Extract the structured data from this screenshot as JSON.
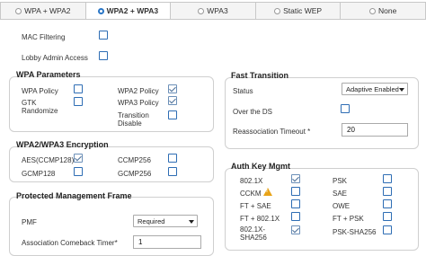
{
  "tabs": [
    {
      "label": "WPA + WPA2",
      "selected": false
    },
    {
      "label": "WPA2 + WPA3",
      "selected": true
    },
    {
      "label": "WPA3",
      "selected": false
    },
    {
      "label": "Static WEP",
      "selected": false
    },
    {
      "label": "None",
      "selected": false
    }
  ],
  "top_options": {
    "mac_filtering": {
      "label": "MAC Filtering",
      "checked": false
    },
    "lobby_admin_access": {
      "label": "Lobby Admin Access",
      "checked": false
    }
  },
  "wpa_parameters": {
    "title": "WPA Parameters",
    "wpa_policy": {
      "label": "WPA Policy",
      "checked": false
    },
    "gtk_randomize": {
      "label_line1": "GTK",
      "label_line2": "Randomize",
      "checked": false
    },
    "wpa2_policy": {
      "label": "WPA2 Policy",
      "checked": true
    },
    "wpa3_policy": {
      "label": "WPA3 Policy",
      "checked": true
    },
    "transition_disable": {
      "label_line1": "Transition",
      "label_line2": "Disable",
      "checked": false
    }
  },
  "encryption": {
    "title": "WPA2/WPA3 Encryption",
    "aes_ccmp128": {
      "label": "AES(CCMP128)",
      "checked": true
    },
    "ccmp256": {
      "label": "CCMP256",
      "checked": false
    },
    "gcmp128": {
      "label": "GCMP128",
      "checked": false
    },
    "gcmp256": {
      "label": "GCMP256",
      "checked": false
    }
  },
  "pmf_section": {
    "title": "Protected Management Frame",
    "pmf_label": "PMF",
    "pmf_value": "Required",
    "comeback_label": "Association Comeback Timer*",
    "comeback_value": "1"
  },
  "fast_transition": {
    "title": "Fast Transition",
    "status_label": "Status",
    "status_value": "Adaptive Enabled",
    "over_ds_label": "Over the DS",
    "over_ds_checked": false,
    "reassoc_label": "Reassociation Timeout *",
    "reassoc_value": "20"
  },
  "auth_key_mgmt": {
    "title": "Auth Key Mgmt",
    "items": [
      {
        "label": "802.1X",
        "checked": true
      },
      {
        "label": "PSK",
        "checked": false
      },
      {
        "label": "CCKM",
        "checked": false,
        "warning": true
      },
      {
        "label": "SAE",
        "checked": false
      },
      {
        "label": "FT + SAE",
        "checked": false
      },
      {
        "label": "OWE",
        "checked": false
      },
      {
        "label": "FT + 802.1X",
        "checked": false
      },
      {
        "label": "FT + PSK",
        "checked": false
      },
      {
        "label_line1": "802.1X-",
        "label_line2": "SHA256",
        "checked": true
      },
      {
        "label": "PSK-SHA256",
        "checked": false
      }
    ]
  },
  "colors": {
    "accent": "#2a76c6",
    "checkbox_border": "#2e6db4",
    "warning": "#e8a317"
  }
}
